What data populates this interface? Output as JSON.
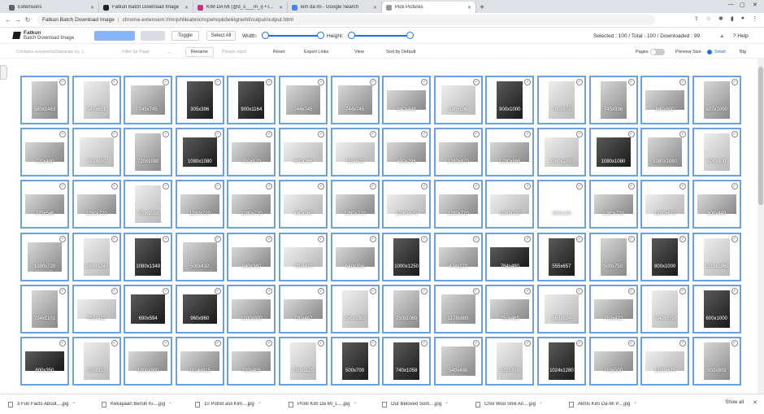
{
  "browser": {
    "tabs": [
      {
        "label": "Extensions",
        "fav": "#5f6368",
        "active": false
      },
      {
        "label": "Fatkun Batch Download Image",
        "fav": "#222222",
        "active": false
      },
      {
        "label": "KIM DA MI (@d_s___m_i) • Insta",
        "fav": "#c13584",
        "active": false
      },
      {
        "label": "kim da mi - Google Search",
        "fav": "#4285f4",
        "active": false
      },
      {
        "label": "Pick Pictures",
        "fav": "#999999",
        "active": true
      }
    ],
    "omnibox": {
      "title": "Fatkun Batch Download Image",
      "url": "chrome-extension://mnjshlikiabnichcpehcpkdeiklgneihf/output/output.html"
    }
  },
  "app": {
    "brand": "Fatkun",
    "subtitle": "Batch Download Image",
    "toggle_label": "Toggle",
    "select_all_label": "Select All",
    "width_label": "Width:",
    "height_label": "Height:",
    "status": "Selected : 100 / Total : 100 / Downloaded : 99",
    "help": "Help",
    "filter_placeholder": "Contains keywords(Separate by ,)",
    "filter_by_page": "Filter by Page",
    "rename": "Rename",
    "please_input": "Please input",
    "reset": "Reset",
    "export_links": "Export Links",
    "view": "View",
    "sort": "Sort by Default",
    "pages": "Pages",
    "preview_size": "Preview Size",
    "small": "Small",
    "big": "Big"
  },
  "images": [
    {
      "size": "580x1463",
      "tone": "m",
      "shape": "t"
    },
    {
      "size": "540x651",
      "tone": "l",
      "shape": "t"
    },
    {
      "size": "745x745",
      "tone": "m",
      "shape": "n"
    },
    {
      "size": "305x396",
      "tone": "d",
      "shape": "t"
    },
    {
      "size": "900x1164",
      "tone": "d",
      "shape": "t"
    },
    {
      "size": "744x745",
      "tone": "m",
      "shape": "n"
    },
    {
      "size": "744x745",
      "tone": "m",
      "shape": "n"
    },
    {
      "size": "640x448",
      "tone": "m",
      "shape": "w"
    },
    {
      "size": "500x596",
      "tone": "l",
      "shape": "n"
    },
    {
      "size": "900x1000",
      "tone": "d",
      "shape": "t"
    },
    {
      "size": "700x875",
      "tone": "l",
      "shape": "t"
    },
    {
      "size": "745x936",
      "tone": "m",
      "shape": "t"
    },
    {
      "size": "840x600",
      "tone": "m",
      "shape": "w"
    },
    {
      "size": "827x1000",
      "tone": "m",
      "shape": "t"
    },
    {
      "size": "720x480",
      "tone": "m",
      "shape": "w"
    },
    {
      "size": "680x680",
      "tone": "l",
      "shape": "n"
    },
    {
      "size": "720x1080",
      "tone": "m",
      "shape": "t"
    },
    {
      "size": "1080x1080",
      "tone": "d",
      "shape": "n"
    },
    {
      "size": "750x570",
      "tone": "m",
      "shape": "w"
    },
    {
      "size": "650x366",
      "tone": "l",
      "shape": "w"
    },
    {
      "size": "750x422",
      "tone": "l",
      "shape": "w"
    },
    {
      "size": "480x296",
      "tone": "m",
      "shape": "w"
    },
    {
      "size": "1280x670",
      "tone": "m",
      "shape": "w"
    },
    {
      "size": "1290x666",
      "tone": "m",
      "shape": "w"
    },
    {
      "size": "1080x1080",
      "tone": "l",
      "shape": "n"
    },
    {
      "size": "1080x1080",
      "tone": "d",
      "shape": "n"
    },
    {
      "size": "1080x1080",
      "tone": "m",
      "shape": "n"
    },
    {
      "size": "600x800",
      "tone": "l",
      "shape": "t"
    },
    {
      "size": "370x546",
      "tone": "m",
      "shape": "w"
    },
    {
      "size": "1280x720",
      "tone": "m",
      "shape": "w"
    },
    {
      "size": "700x1050",
      "tone": "l",
      "shape": "t"
    },
    {
      "size": "1280x720",
      "tone": "m",
      "shape": "w"
    },
    {
      "size": "1280x720",
      "tone": "m",
      "shape": "w"
    },
    {
      "size": "480x360",
      "tone": "l",
      "shape": "w"
    },
    {
      "size": "1280x720",
      "tone": "m",
      "shape": "w"
    },
    {
      "size": "1200x675",
      "tone": "l",
      "shape": "w"
    },
    {
      "size": "1280x720",
      "tone": "m",
      "shape": "w"
    },
    {
      "size": "1280x720",
      "tone": "l",
      "shape": "w"
    },
    {
      "size": "380x186",
      "tone": "e",
      "shape": "w"
    },
    {
      "size": "1280x720",
      "tone": "m",
      "shape": "w"
    },
    {
      "size": "1200x672",
      "tone": "l",
      "shape": "w"
    },
    {
      "size": "800x449",
      "tone": "m",
      "shape": "w"
    },
    {
      "size": "1080x720",
      "tone": "m",
      "shape": "n"
    },
    {
      "size": "1080x1347",
      "tone": "l",
      "shape": "t"
    },
    {
      "size": "1080x1349",
      "tone": "d",
      "shape": "t"
    },
    {
      "size": "500x432",
      "tone": "m",
      "shape": "n"
    },
    {
      "size": "640x360",
      "tone": "m",
      "shape": "w"
    },
    {
      "size": "720x410",
      "tone": "l",
      "shape": "w"
    },
    {
      "size": "640x358",
      "tone": "m",
      "shape": "w"
    },
    {
      "size": "1000x1250",
      "tone": "d",
      "shape": "t"
    },
    {
      "size": "474x270",
      "tone": "m",
      "shape": "w"
    },
    {
      "size": "764x480",
      "tone": "d",
      "shape": "w"
    },
    {
      "size": "555x657",
      "tone": "d",
      "shape": "t"
    },
    {
      "size": "500x750",
      "tone": "m",
      "shape": "t"
    },
    {
      "size": "800x1000",
      "tone": "d",
      "shape": "t"
    },
    {
      "size": "1313x1969",
      "tone": "l",
      "shape": "t"
    },
    {
      "size": "734x1101",
      "tone": "m",
      "shape": "t"
    },
    {
      "size": "750x422",
      "tone": "l",
      "shape": "w"
    },
    {
      "size": "690x594",
      "tone": "d",
      "shape": "n"
    },
    {
      "size": "960x960",
      "tone": "d",
      "shape": "n"
    },
    {
      "size": "1200x800",
      "tone": "m",
      "shape": "w"
    },
    {
      "size": "700x467",
      "tone": "m",
      "shape": "w"
    },
    {
      "size": "750x1069",
      "tone": "l",
      "shape": "t"
    },
    {
      "size": "750x1069",
      "tone": "m",
      "shape": "t"
    },
    {
      "size": "1178x885",
      "tone": "m",
      "shape": "n"
    },
    {
      "size": "750x469",
      "tone": "m",
      "shape": "w"
    },
    {
      "size": "663x624",
      "tone": "l",
      "shape": "n"
    },
    {
      "size": "750x422",
      "tone": "m",
      "shape": "w"
    },
    {
      "size": "540x675",
      "tone": "l",
      "shape": "t"
    },
    {
      "size": "600x1000",
      "tone": "d",
      "shape": "t"
    },
    {
      "size": "600x350",
      "tone": "d",
      "shape": "w"
    },
    {
      "size": "700x933",
      "tone": "l",
      "shape": "t"
    },
    {
      "size": "1600x900",
      "tone": "m",
      "shape": "w"
    },
    {
      "size": "1014x615",
      "tone": "m",
      "shape": "w"
    },
    {
      "size": "720x405",
      "tone": "m",
      "shape": "w"
    },
    {
      "size": "750x1125",
      "tone": "l",
      "shape": "t"
    },
    {
      "size": "500x700",
      "tone": "d",
      "shape": "t"
    },
    {
      "size": "740x1058",
      "tone": "d",
      "shape": "t"
    },
    {
      "size": "540x488",
      "tone": "m",
      "shape": "n"
    },
    {
      "size": "512x768",
      "tone": "l",
      "shape": "t"
    },
    {
      "size": "1024x1280",
      "tone": "d",
      "shape": "t"
    },
    {
      "size": "750x500",
      "tone": "m",
      "shape": "w"
    },
    {
      "size": "1200x675",
      "tone": "l",
      "shape": "w"
    },
    {
      "size": "602x903",
      "tone": "m",
      "shape": "t"
    }
  ],
  "downloads": [
    "3 Fun Facts About....jpg",
    "Kekayaan Bersih Ki....jpg",
    "10 Potret asli Kim....jpg",
    "Profil Kim Da Mi_L....jpg",
    "Our Beloved Sum....jpg",
    "Choi Woo Shik An....jpg",
    "Aktris Kim Da-Mi P....jpg"
  ],
  "show_all": "Show all"
}
